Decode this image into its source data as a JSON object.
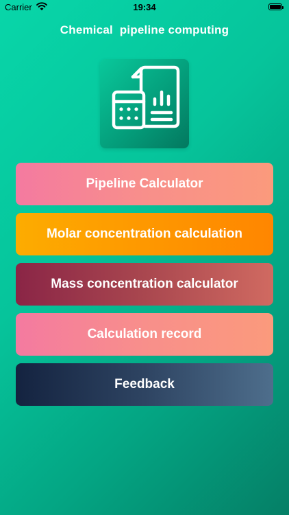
{
  "status_bar": {
    "carrier": "Carrier",
    "time": "19:34",
    "icons": [
      "wifi-icon",
      "battery-icon"
    ]
  },
  "header": {
    "title": "Chemical  pipeline computing"
  },
  "logo": {
    "icon": "calculator-document-chart-icon"
  },
  "menu": {
    "items": [
      {
        "label": "Pipeline Calculator"
      },
      {
        "label": "Molar concentration calculation"
      },
      {
        "label": "Mass concentration calculator"
      },
      {
        "label": "Calculation record"
      },
      {
        "label": "Feedback"
      }
    ]
  },
  "colors": {
    "background_start": "#08d6a9",
    "background_end": "#057f66",
    "pipeline_button": "#f88f8b",
    "molar_button": "#fe9800",
    "mass_button": "#a9474f",
    "record_button": "#f88f8b",
    "feedback_button": "#2e4462"
  }
}
